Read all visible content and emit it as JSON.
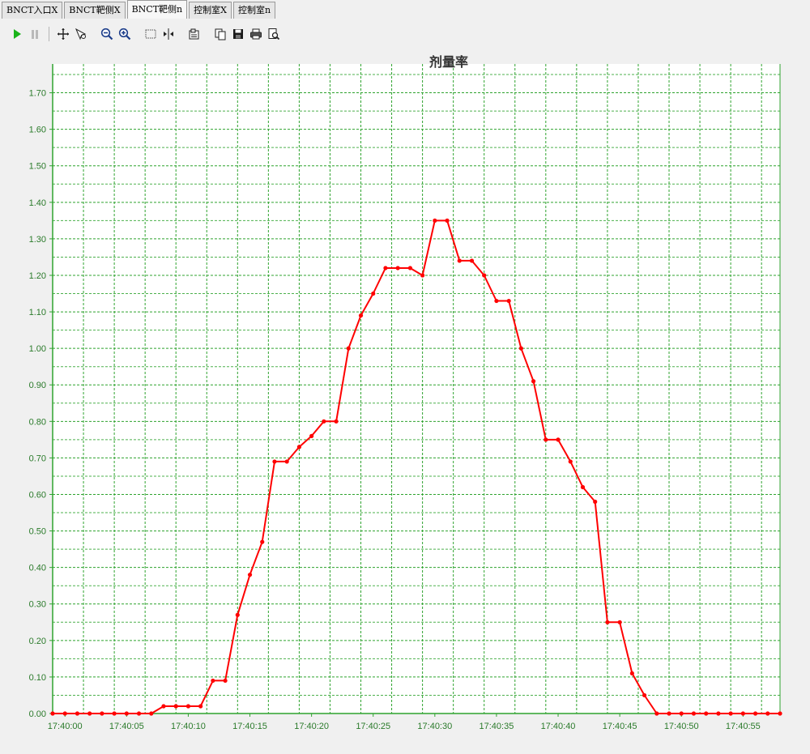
{
  "tabs": [
    {
      "label": "BNCT入口X",
      "active": false
    },
    {
      "label": "BNCT靶侧X",
      "active": false
    },
    {
      "label": "BNCT靶侧n",
      "active": true
    },
    {
      "label": "控制室X",
      "active": false
    },
    {
      "label": "控制室n",
      "active": false
    }
  ],
  "toolbar": {
    "icons": [
      "play-icon",
      "pause-icon",
      "pan-icon",
      "zoom-select-icon",
      "zoom-out-icon",
      "zoom-in-icon",
      "select-rect-icon",
      "cursor-icon",
      "properties-icon",
      "copy-icon",
      "save-icon",
      "print-icon",
      "print-preview-icon"
    ]
  },
  "colors": {
    "grid": "#2fa32f",
    "axis": "#2fa32f",
    "series": "#ff0000",
    "background": "#ffffff"
  },
  "chart_data": {
    "type": "line",
    "title": "剂量率",
    "xlabel": "",
    "ylabel": "",
    "x_range_seconds_from": "17:39:59",
    "xlim": [
      "17:39:59",
      "17:40:58"
    ],
    "ylim": [
      0,
      1.77
    ],
    "y_ticks": [
      0.0,
      0.1,
      0.2,
      0.3,
      0.4,
      0.5,
      0.6,
      0.7,
      0.8,
      0.9,
      1.0,
      1.1,
      1.2,
      1.3,
      1.4,
      1.5,
      1.6,
      1.7
    ],
    "y_tick_labels": [
      "0.00",
      "0.10",
      "0.20",
      "0.30",
      "0.40",
      "0.50",
      "0.60",
      "0.70",
      "0.80",
      "0.90",
      "1.00",
      "1.10",
      "1.20",
      "1.30",
      "1.40",
      "1.50",
      "1.60",
      "1.70"
    ],
    "x_tick_labels": [
      "17:40:00",
      "17:40:05",
      "17:40:10",
      "17:40:15",
      "17:40:20",
      "17:40:25",
      "17:40:30",
      "17:40:35",
      "17:40:40",
      "17:40:45",
      "17:40:50",
      "17:40:55"
    ],
    "grid": true,
    "series": [
      {
        "x": [
          "17:39:59",
          "17:40:00",
          "17:40:01",
          "17:40:02",
          "17:40:03",
          "17:40:04",
          "17:40:05",
          "17:40:06",
          "17:40:07",
          "17:40:08",
          "17:40:09",
          "17:40:10",
          "17:40:11",
          "17:40:12",
          "17:40:13",
          "17:40:14",
          "17:40:15",
          "17:40:16",
          "17:40:17",
          "17:40:18",
          "17:40:19",
          "17:40:20",
          "17:40:21",
          "17:40:22",
          "17:40:23",
          "17:40:24",
          "17:40:25",
          "17:40:26",
          "17:40:27",
          "17:40:28",
          "17:40:29",
          "17:40:30",
          "17:40:31",
          "17:40:32",
          "17:40:33",
          "17:40:34",
          "17:40:35",
          "17:40:36",
          "17:40:37",
          "17:40:38",
          "17:40:39",
          "17:40:40",
          "17:40:41",
          "17:40:42",
          "17:40:43",
          "17:40:44",
          "17:40:45",
          "17:40:46",
          "17:40:47",
          "17:40:48",
          "17:40:49",
          "17:40:50",
          "17:40:51",
          "17:40:52",
          "17:40:53",
          "17:40:54",
          "17:40:55",
          "17:40:56",
          "17:40:57",
          "17:40:58"
        ],
        "values": [
          0,
          0,
          0,
          0,
          0,
          0,
          0,
          0,
          0,
          0.02,
          0.02,
          0.02,
          0.02,
          0.09,
          0.09,
          0.27,
          0.38,
          0.47,
          0.69,
          0.69,
          0.73,
          0.76,
          0.8,
          0.8,
          1.0,
          1.09,
          1.15,
          1.22,
          1.22,
          1.22,
          1.2,
          1.35,
          1.35,
          1.24,
          1.24,
          1.2,
          1.13,
          1.13,
          1.0,
          0.91,
          0.75,
          0.75,
          0.69,
          0.62,
          0.58,
          0.25,
          0.25,
          0.11,
          0.05,
          0,
          0,
          0,
          0,
          0,
          0,
          0,
          0,
          0,
          0,
          0
        ]
      }
    ]
  }
}
